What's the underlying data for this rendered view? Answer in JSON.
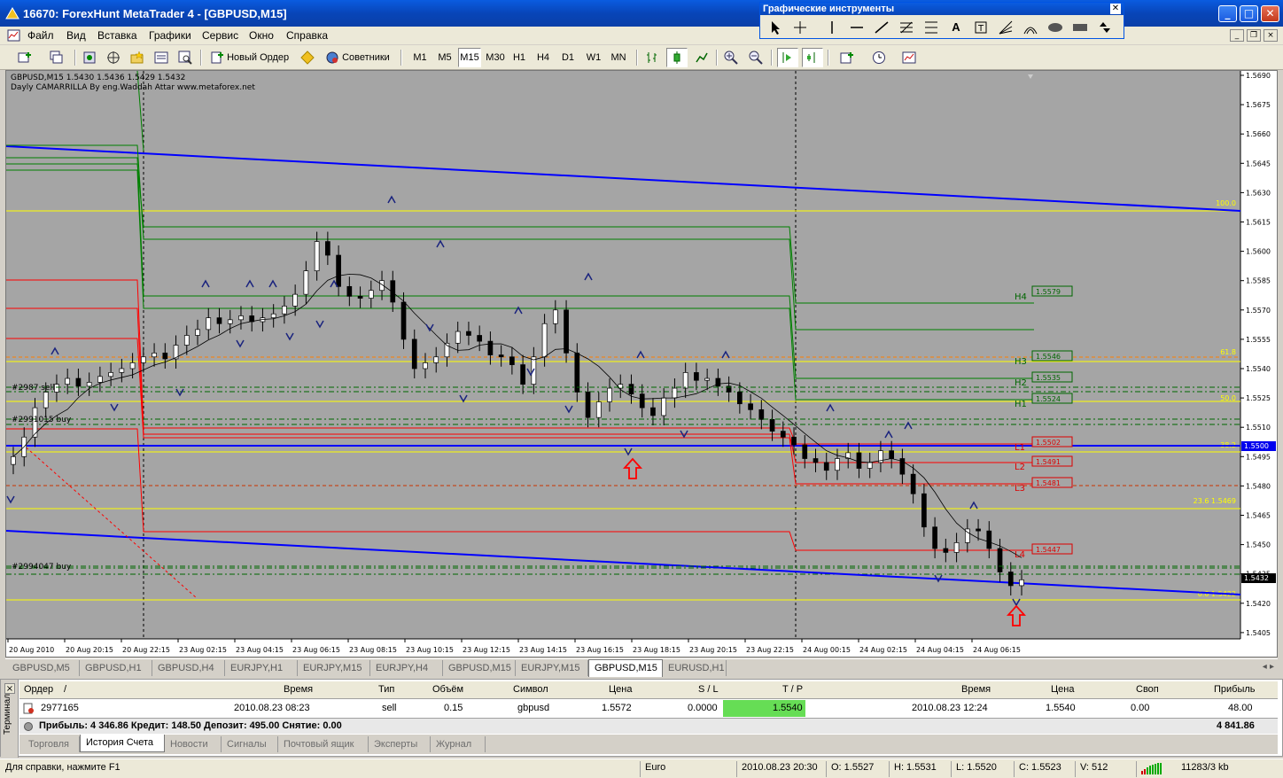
{
  "window": {
    "title": "16670: ForexHunt MetaTrader 4 - [GBPUSD,M15]",
    "min_label": "_",
    "max_label": "□",
    "close_label": "✕"
  },
  "menu": {
    "items": [
      "Файл",
      "Вид",
      "Вставка",
      "Графики",
      "Сервис",
      "Окно",
      "Справка"
    ],
    "mdi_min": "_",
    "mdi_restore": "❐",
    "mdi_close": "×"
  },
  "toolbar": {
    "new_order": "Новый Ордер",
    "advisors": "Советники",
    "timeframes": [
      "M1",
      "M5",
      "M15",
      "M30",
      "H1",
      "H4",
      "D1",
      "W1",
      "MN"
    ],
    "active_timeframe": "M15"
  },
  "graph_tools": {
    "title": "Графические инструменты",
    "close_label": "✕",
    "tools": [
      "cursor-icon",
      "crosshair-icon",
      "vertical-line-icon",
      "horizontal-line-icon",
      "trendline-icon",
      "fibo-icon",
      "text-icon",
      "text-label-icon",
      "fibo-fan-icon",
      "fibo-arc-icon",
      "ellipse-icon",
      "rectangle-icon",
      "arrows-icon"
    ],
    "text_tool_label": "A"
  },
  "chart": {
    "symbol_info": "GBPUSD,M15  1.5430 1.5436 1.5429 1.5432",
    "indicator_info": "Dayly CAMARRILLA By eng.Waddah Attar www.metaforex.net",
    "price_ticks": [
      "1.5690",
      "1.5675",
      "1.5660",
      "1.5645",
      "1.5630",
      "1.5615",
      "1.5600",
      "1.5585",
      "1.5570",
      "1.5555",
      "1.5540",
      "1.5525",
      "1.5510",
      "1.5495",
      "1.5480",
      "1.5465",
      "1.5450",
      "1.5435",
      "1.5420",
      "1.5405"
    ],
    "time_ticks": [
      "20 Aug 2010",
      "20 Aug 20:15",
      "20 Aug 22:15",
      "23 Aug 02:15",
      "23 Aug 04:15",
      "23 Aug 06:15",
      "23 Aug 08:15",
      "23 Aug 10:15",
      "23 Aug 12:15",
      "23 Aug 14:15",
      "23 Aug 16:15",
      "23 Aug 18:15",
      "23 Aug 20:15",
      "23 Aug 22:15",
      "24 Aug 00:15",
      "24 Aug 02:15",
      "24 Aug 04:15",
      "24 Aug 06:15"
    ],
    "current_price": "1.5432",
    "blue_level_price": "1.5500",
    "camarilla_labels": [
      {
        "name": "H4",
        "value": "1.5579"
      },
      {
        "name": "H3",
        "value": "1.5546"
      },
      {
        "name": "H2",
        "value": "1.5535"
      },
      {
        "name": "H1",
        "value": "1.5524"
      },
      {
        "name": "L1",
        "value": "1.5502"
      },
      {
        "name": "L2",
        "value": "1.5491"
      },
      {
        "name": "L3",
        "value": "1.5481"
      },
      {
        "name": "L4",
        "value": "1.5447"
      }
    ],
    "fibo_labels": [
      "100.0",
      "61.8",
      "50.0",
      "38.2",
      "23.6 1.5469",
      "0.0 1.5422"
    ],
    "order_labels": [
      "#2987 sell",
      "#2991015 buy",
      "#2994047 buy"
    ],
    "colors": {
      "background": "#a5a5a5",
      "bull": "#ffffff",
      "bear": "#000000",
      "channel": "#0000ff",
      "resistance": "#008000",
      "support": "#ff0000",
      "fibo": "#ffff00"
    }
  },
  "chart_tabs": {
    "items": [
      "GBPUSD,M5",
      "GBPUSD,H1",
      "GBPUSD,H4",
      "EURJPY,H1",
      "EURJPY,M15",
      "EURJPY,H4",
      "GBPUSD,M15",
      "EURJPY,M15",
      "GBPUSD,M15",
      "EURUSD,H1"
    ],
    "active_index": 8
  },
  "terminal": {
    "side_label": "Терминал",
    "columns": [
      "Ордер",
      "/",
      "Время",
      "Тип",
      "Объём",
      "Символ",
      "Цена",
      "S / L",
      "T / P",
      "Время",
      "Цена",
      "Своп",
      "Прибыль"
    ],
    "row": {
      "order": "2977165",
      "open_time": "2010.08.23 08:23",
      "type": "sell",
      "volume": "0.15",
      "symbol": "gbpusd",
      "price": "1.5572",
      "sl": "0.0000",
      "tp": "1.5540",
      "close_time": "2010.08.23 12:24",
      "close_price": "1.5540",
      "swap": "0.00",
      "profit": "48.00"
    },
    "summary": "Прибыль: 4 346.86  Кредит: 148.50  Депозит: 495.00  Снятие: 0.00",
    "summary_total": "4 841.86",
    "tabs": [
      "Торговля",
      "История Счета",
      "Новости",
      "Сигналы",
      "Почтовый ящик",
      "Эксперты",
      "Журнал"
    ],
    "active_tab": 1
  },
  "status": {
    "help": "Для справки, нажмите F1",
    "profile": "Euro",
    "datetime": "2010.08.23 20:30",
    "open": "O: 1.5527",
    "high": "H: 1.5531",
    "low": "L: 1.5520",
    "close": "C: 1.5523",
    "volume": "V: 512",
    "traffic": "11283/3 kb"
  }
}
